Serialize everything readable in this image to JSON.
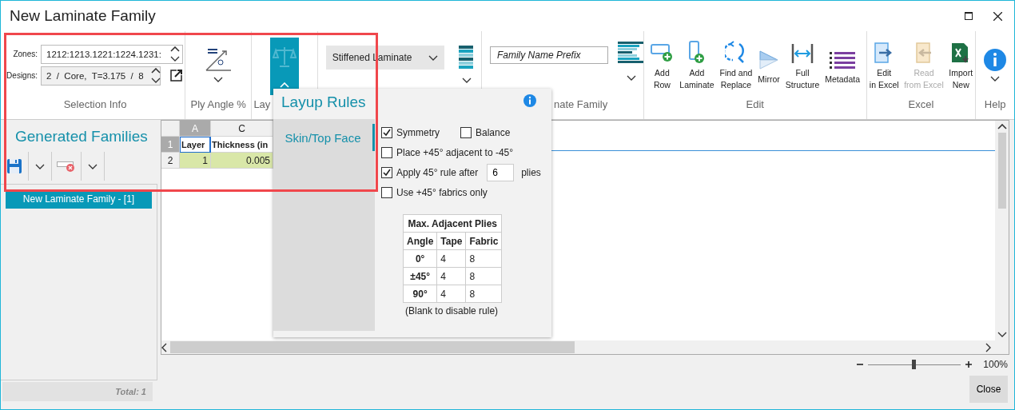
{
  "window": {
    "title": "New Laminate Family"
  },
  "selection_info": {
    "zones_label": "Zones:",
    "zones_value": "1212:1213.1221:1224.1231:",
    "designs_label": "Designs:",
    "designs_value": "2  /  Core,  T=3.175  /  8",
    "label": "Selection Info"
  },
  "ply_angle": {
    "label": "Ply Angle %"
  },
  "layup": {
    "label": "Lay",
    "selected": true
  },
  "laminate_type": {
    "value": "Stiffened Laminate"
  },
  "family": {
    "placeholder": "Family Name Prefix",
    "label": "nate Family"
  },
  "edit": {
    "label": "Edit",
    "buttons": [
      {
        "kind": "add-row",
        "label": "Add\nRow",
        "disabled": false
      },
      {
        "kind": "add-laminate",
        "label": "Add\nLaminate",
        "disabled": false
      },
      {
        "kind": "find-replace",
        "label": "Find and\nReplace",
        "disabled": false
      },
      {
        "kind": "mirror",
        "label": "Mirror",
        "disabled": false
      },
      {
        "kind": "full-structure",
        "label": "Full\nStructure",
        "disabled": false
      },
      {
        "kind": "metadata",
        "label": "Metadata",
        "disabled": false
      }
    ]
  },
  "excel": {
    "label": "Excel",
    "buttons": [
      {
        "kind": "edit-excel",
        "label": "Edit\nin Excel",
        "disabled": false
      },
      {
        "kind": "read-excel",
        "label": "Read\nfrom Excel",
        "disabled": true
      },
      {
        "kind": "import-new",
        "label": "Import\nNew",
        "disabled": false
      }
    ]
  },
  "help": {
    "label": "Help"
  },
  "families_panel": {
    "title": "Generated Families",
    "items": [
      {
        "label": "New Laminate Family - [1]",
        "selected": true
      }
    ],
    "total": "Total: 1"
  },
  "sheet": {
    "columns": [
      {
        "label": "A",
        "selected": true
      },
      {
        "label": "C",
        "selected": false
      }
    ],
    "rows": [
      {
        "number": "1",
        "selected": true,
        "kind": "header",
        "cells": [
          "Layer",
          "Thickness (in"
        ]
      },
      {
        "number": "2",
        "selected": false,
        "kind": "data",
        "cells": [
          "1",
          "0.005"
        ]
      }
    ]
  },
  "zoom": {
    "level": 0.5,
    "reading": "100%"
  },
  "close_button": "Close",
  "layup_popup": {
    "title": "Layup Rules",
    "tabs": [
      {
        "label": "Skin/Top Face",
        "selected": true
      }
    ],
    "option_rows": [
      [
        {
          "label": "Symmetry",
          "checked": true
        },
        {
          "label": "Balance",
          "checked": false
        }
      ],
      [
        {
          "label": "Place +45° adjacent to -45°",
          "checked": false
        }
      ],
      [
        {
          "label": "Apply 45° rule after",
          "checked": true,
          "value": "6",
          "suffix": "plies"
        }
      ],
      [
        {
          "label": "Use +45° fabrics only",
          "checked": false
        }
      ]
    ],
    "table": {
      "title": "Max. Adjacent Plies",
      "columns": [
        "Angle",
        "Tape",
        "Fabric"
      ],
      "rows": [
        [
          "0°",
          "4",
          "8"
        ],
        [
          "±45°",
          "4",
          "8"
        ],
        [
          "90°",
          "4",
          "8"
        ]
      ]
    },
    "note": "(Blank to disable rule)"
  }
}
